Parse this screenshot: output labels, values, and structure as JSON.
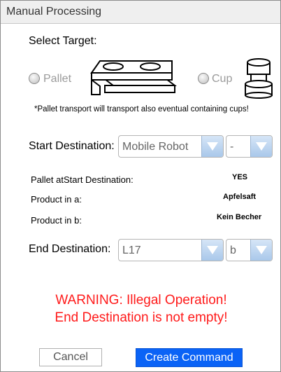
{
  "window": {
    "title": "Manual Processing"
  },
  "target": {
    "heading": "Select Target:",
    "pallet_label": "Pallet",
    "cup_label": "Cup",
    "note": "*Pallet transport will transport also eventual containing cups!"
  },
  "start": {
    "label": "Start Destination:",
    "location_value": "Mobile Robot",
    "slot_value": "-"
  },
  "info": {
    "pallet_label": "Pallet atStart Destination:",
    "pallet_value": "YES",
    "product_a_label": "Product in a:",
    "product_a_value": "Apfelsaft",
    "product_b_label": "Product in b:",
    "product_b_value": "Kein Becher"
  },
  "end": {
    "label": "End Destination:",
    "location_value": "L17",
    "slot_value": "b"
  },
  "warning": {
    "line1": "WARNING: Illegal Operation!",
    "line2": "End Destination is not empty!"
  },
  "buttons": {
    "cancel": "Cancel",
    "create": "Create Command"
  },
  "colors": {
    "warning": "#ff1a1a",
    "primary_button": "#0b63f6",
    "dropdown_button": "#a9c8ea"
  }
}
